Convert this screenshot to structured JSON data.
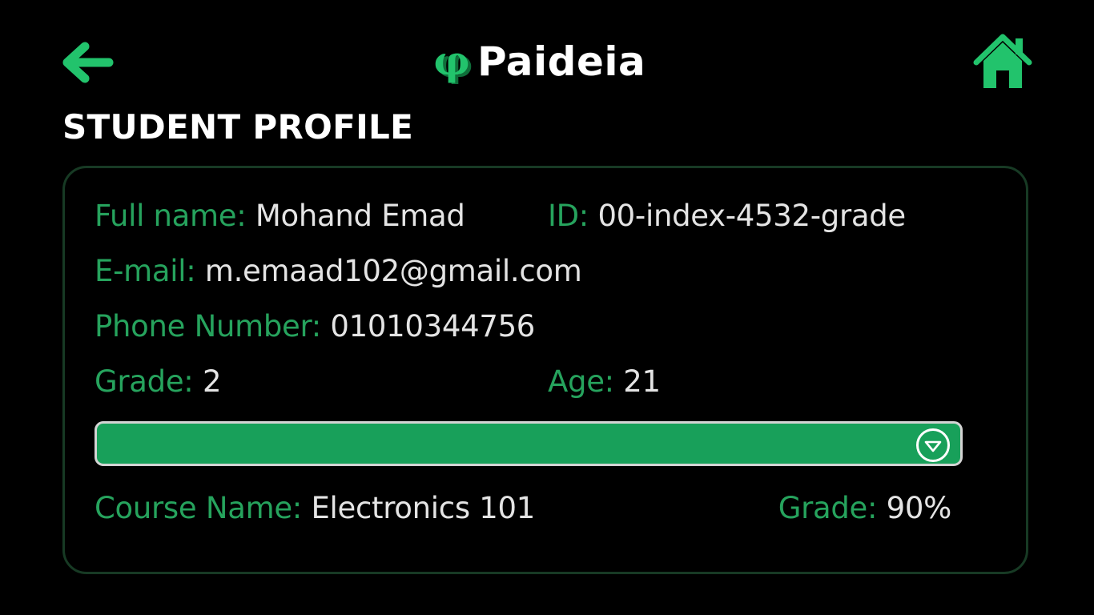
{
  "header": {
    "brand_name": "Paideia",
    "logo_glyph": "φ"
  },
  "page_title": "STUDENT PROFILE",
  "profile": {
    "full_name_label": "Full name:",
    "full_name": "Mohand Emad",
    "id_label": "ID:",
    "id": "00-index-4532-grade",
    "email_label": "E-mail:",
    "email": "m.emaad102@gmail.com",
    "phone_label": "Phone Number:",
    "phone": "01010344756",
    "grade_label": "Grade:",
    "grade": "2",
    "age_label": "Age:",
    "age": "21"
  },
  "course": {
    "name_label": "Course Name:",
    "name": "Electronics 101",
    "grade_label": "Grade:",
    "grade": "90%"
  },
  "icons": {
    "back": "arrow-left-icon",
    "home": "home-icon",
    "logo": "paideia-logo",
    "toggle": "chevron-down-circle-icon"
  },
  "colors": {
    "background": "#000000",
    "accent": "#22c36c",
    "label": "#26a35d",
    "value": "#e4e4e4",
    "bar": "#18a05a",
    "card_border": "#173a24"
  }
}
